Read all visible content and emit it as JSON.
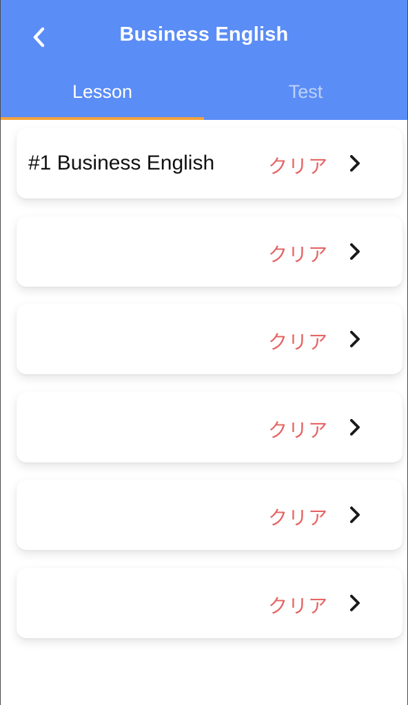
{
  "header": {
    "title": "Business English",
    "back_icon": "chevron-left-icon"
  },
  "tabs": [
    {
      "label": "Lesson",
      "active": true
    },
    {
      "label": "Test",
      "active": false
    }
  ],
  "colors": {
    "header_bg": "#5B8DF6",
    "tab_indicator": "#F3A23D",
    "status_text": "#E56463"
  },
  "lessons": [
    {
      "title": "#1 Business English",
      "status": "クリア"
    },
    {
      "title": "",
      "status": "クリア"
    },
    {
      "title": "",
      "status": "クリア"
    },
    {
      "title": "",
      "status": "クリア"
    },
    {
      "title": "",
      "status": "クリア"
    },
    {
      "title": "",
      "status": "クリア"
    }
  ]
}
